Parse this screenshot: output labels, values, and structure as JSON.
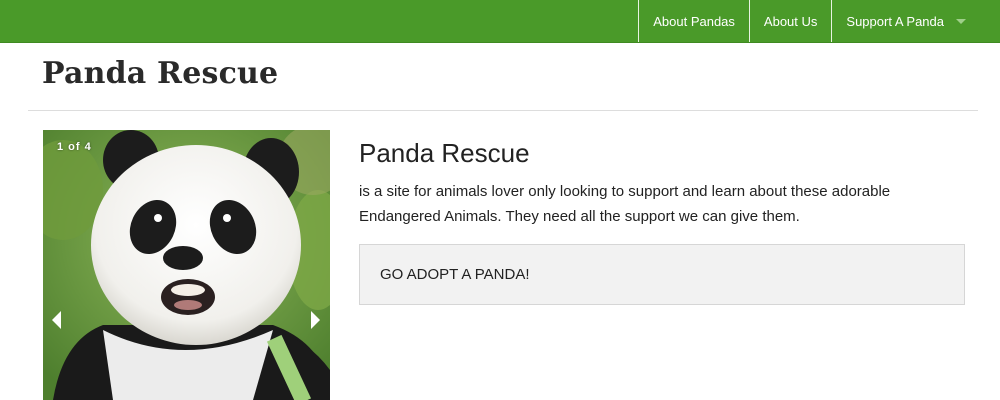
{
  "nav": {
    "items": [
      {
        "label": "About Pandas"
      },
      {
        "label": "About Us"
      },
      {
        "label": "Support A Panda"
      }
    ]
  },
  "site": {
    "title": "Panda Rescue"
  },
  "slideshow": {
    "counter": "1 of 4",
    "current": 1,
    "total": 4
  },
  "content": {
    "title": "Panda Rescue",
    "text": "is a site for animals lover only looking to support and learn about these adorable Endangered Animals. They need all the support we can give them.",
    "cta": "GO ADOPT A PANDA!"
  },
  "colors": {
    "nav_bg": "#4a9a29",
    "cta_bg": "#f2f2f2"
  }
}
